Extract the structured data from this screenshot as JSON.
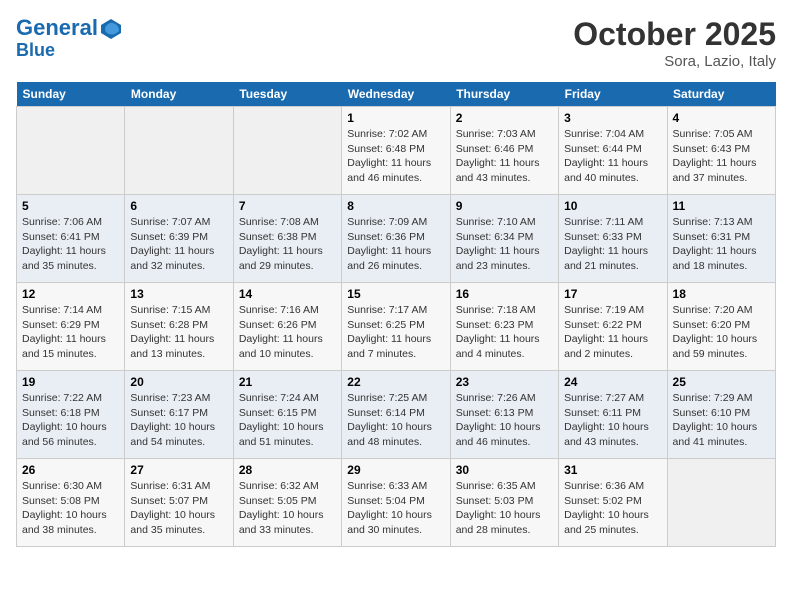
{
  "header": {
    "logo_line1": "General",
    "logo_line2": "Blue",
    "month": "October 2025",
    "location": "Sora, Lazio, Italy"
  },
  "weekdays": [
    "Sunday",
    "Monday",
    "Tuesday",
    "Wednesday",
    "Thursday",
    "Friday",
    "Saturday"
  ],
  "weeks": [
    [
      {
        "day": "",
        "info": ""
      },
      {
        "day": "",
        "info": ""
      },
      {
        "day": "",
        "info": ""
      },
      {
        "day": "1",
        "info": "Sunrise: 7:02 AM\nSunset: 6:48 PM\nDaylight: 11 hours and 46 minutes."
      },
      {
        "day": "2",
        "info": "Sunrise: 7:03 AM\nSunset: 6:46 PM\nDaylight: 11 hours and 43 minutes."
      },
      {
        "day": "3",
        "info": "Sunrise: 7:04 AM\nSunset: 6:44 PM\nDaylight: 11 hours and 40 minutes."
      },
      {
        "day": "4",
        "info": "Sunrise: 7:05 AM\nSunset: 6:43 PM\nDaylight: 11 hours and 37 minutes."
      }
    ],
    [
      {
        "day": "5",
        "info": "Sunrise: 7:06 AM\nSunset: 6:41 PM\nDaylight: 11 hours and 35 minutes."
      },
      {
        "day": "6",
        "info": "Sunrise: 7:07 AM\nSunset: 6:39 PM\nDaylight: 11 hours and 32 minutes."
      },
      {
        "day": "7",
        "info": "Sunrise: 7:08 AM\nSunset: 6:38 PM\nDaylight: 11 hours and 29 minutes."
      },
      {
        "day": "8",
        "info": "Sunrise: 7:09 AM\nSunset: 6:36 PM\nDaylight: 11 hours and 26 minutes."
      },
      {
        "day": "9",
        "info": "Sunrise: 7:10 AM\nSunset: 6:34 PM\nDaylight: 11 hours and 23 minutes."
      },
      {
        "day": "10",
        "info": "Sunrise: 7:11 AM\nSunset: 6:33 PM\nDaylight: 11 hours and 21 minutes."
      },
      {
        "day": "11",
        "info": "Sunrise: 7:13 AM\nSunset: 6:31 PM\nDaylight: 11 hours and 18 minutes."
      }
    ],
    [
      {
        "day": "12",
        "info": "Sunrise: 7:14 AM\nSunset: 6:29 PM\nDaylight: 11 hours and 15 minutes."
      },
      {
        "day": "13",
        "info": "Sunrise: 7:15 AM\nSunset: 6:28 PM\nDaylight: 11 hours and 13 minutes."
      },
      {
        "day": "14",
        "info": "Sunrise: 7:16 AM\nSunset: 6:26 PM\nDaylight: 11 hours and 10 minutes."
      },
      {
        "day": "15",
        "info": "Sunrise: 7:17 AM\nSunset: 6:25 PM\nDaylight: 11 hours and 7 minutes."
      },
      {
        "day": "16",
        "info": "Sunrise: 7:18 AM\nSunset: 6:23 PM\nDaylight: 11 hours and 4 minutes."
      },
      {
        "day": "17",
        "info": "Sunrise: 7:19 AM\nSunset: 6:22 PM\nDaylight: 11 hours and 2 minutes."
      },
      {
        "day": "18",
        "info": "Sunrise: 7:20 AM\nSunset: 6:20 PM\nDaylight: 10 hours and 59 minutes."
      }
    ],
    [
      {
        "day": "19",
        "info": "Sunrise: 7:22 AM\nSunset: 6:18 PM\nDaylight: 10 hours and 56 minutes."
      },
      {
        "day": "20",
        "info": "Sunrise: 7:23 AM\nSunset: 6:17 PM\nDaylight: 10 hours and 54 minutes."
      },
      {
        "day": "21",
        "info": "Sunrise: 7:24 AM\nSunset: 6:15 PM\nDaylight: 10 hours and 51 minutes."
      },
      {
        "day": "22",
        "info": "Sunrise: 7:25 AM\nSunset: 6:14 PM\nDaylight: 10 hours and 48 minutes."
      },
      {
        "day": "23",
        "info": "Sunrise: 7:26 AM\nSunset: 6:13 PM\nDaylight: 10 hours and 46 minutes."
      },
      {
        "day": "24",
        "info": "Sunrise: 7:27 AM\nSunset: 6:11 PM\nDaylight: 10 hours and 43 minutes."
      },
      {
        "day": "25",
        "info": "Sunrise: 7:29 AM\nSunset: 6:10 PM\nDaylight: 10 hours and 41 minutes."
      }
    ],
    [
      {
        "day": "26",
        "info": "Sunrise: 6:30 AM\nSunset: 5:08 PM\nDaylight: 10 hours and 38 minutes."
      },
      {
        "day": "27",
        "info": "Sunrise: 6:31 AM\nSunset: 5:07 PM\nDaylight: 10 hours and 35 minutes."
      },
      {
        "day": "28",
        "info": "Sunrise: 6:32 AM\nSunset: 5:05 PM\nDaylight: 10 hours and 33 minutes."
      },
      {
        "day": "29",
        "info": "Sunrise: 6:33 AM\nSunset: 5:04 PM\nDaylight: 10 hours and 30 minutes."
      },
      {
        "day": "30",
        "info": "Sunrise: 6:35 AM\nSunset: 5:03 PM\nDaylight: 10 hours and 28 minutes."
      },
      {
        "day": "31",
        "info": "Sunrise: 6:36 AM\nSunset: 5:02 PM\nDaylight: 10 hours and 25 minutes."
      },
      {
        "day": "",
        "info": ""
      }
    ]
  ]
}
